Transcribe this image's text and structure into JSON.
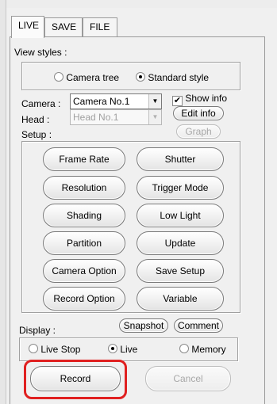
{
  "tabs": [
    {
      "label": "LIVE",
      "active": true
    },
    {
      "label": "SAVE",
      "active": false
    },
    {
      "label": "FILE",
      "active": false
    }
  ],
  "view_styles": {
    "label": "View styles :",
    "options": [
      {
        "label": "Camera tree",
        "selected": false
      },
      {
        "label": "Standard style",
        "selected": true
      }
    ]
  },
  "camera": {
    "label": "Camera :",
    "value": "Camera No.1",
    "show_info_label": "Show info",
    "show_info_checked": true,
    "edit_info_label": "Edit info"
  },
  "head": {
    "label": "Head :",
    "value": "Head No.1",
    "graph_label": "Graph"
  },
  "setup": {
    "label": "Setup :",
    "buttons": [
      "Frame Rate",
      "Shutter",
      "Resolution",
      "Trigger Mode",
      "Shading",
      "Low Light",
      "Partition",
      "Update",
      "Camera Option",
      "Save Setup",
      "Record Option",
      "Variable"
    ]
  },
  "display": {
    "label": "Display :",
    "snapshot_label": "Snapshot",
    "comment_label": "Comment",
    "options": [
      {
        "label": "Live Stop",
        "selected": false
      },
      {
        "label": "Live",
        "selected": true
      },
      {
        "label": "Memory",
        "selected": false
      }
    ]
  },
  "actions": {
    "record_label": "Record",
    "cancel_label": "Cancel"
  },
  "colors": {
    "highlight": "#e02020",
    "background": "#f0f0f0"
  }
}
